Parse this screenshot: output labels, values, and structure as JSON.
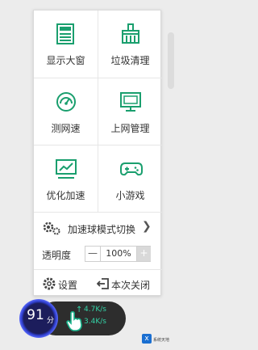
{
  "menu": {
    "tiles": [
      {
        "label": "显示大窗",
        "icon": "display-window-icon"
      },
      {
        "label": "垃圾清理",
        "icon": "broom-cleanup-icon"
      },
      {
        "label": "测网速",
        "icon": "speedometer-icon"
      },
      {
        "label": "上网管理",
        "icon": "monitor-manage-icon"
      },
      {
        "label": "优化加速",
        "icon": "optimize-chart-icon"
      },
      {
        "label": "小游戏",
        "icon": "gamepad-icon"
      }
    ],
    "skin_switch_label": "加速球模式切换",
    "opacity_label": "透明度",
    "opacity_value": "100%",
    "minus_label": "—",
    "plus_label": "+",
    "settings_label": "设置",
    "close_label": "本次关闭"
  },
  "ball": {
    "score": "91",
    "score_unit": "分",
    "upload": "4.7K/s",
    "download": "3.4K/s",
    "up_arrow": "↑",
    "down_arrow": "↓"
  },
  "watermark": {
    "mark": "x",
    "text": "系统天地"
  },
  "colors": {
    "accent_green": "#1a9f6e",
    "ball_blue": "#3b4cff",
    "pill_bg": "#2d2d2d"
  }
}
